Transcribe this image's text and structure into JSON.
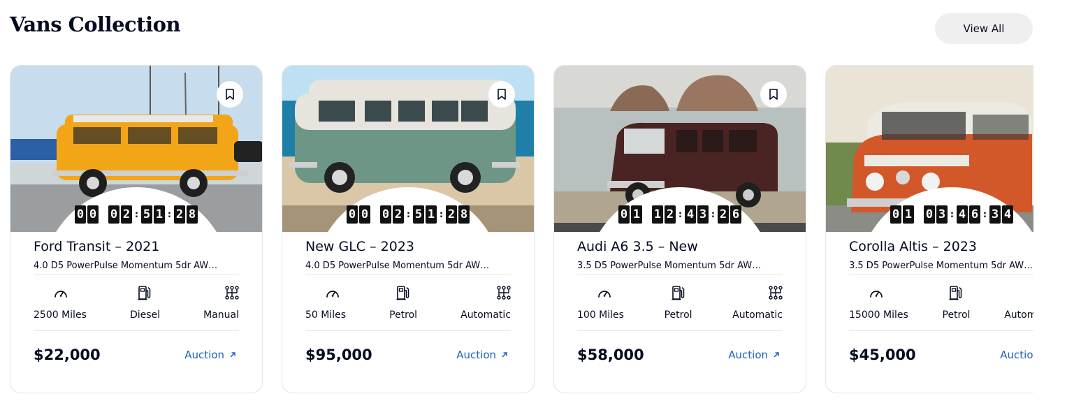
{
  "section": {
    "title": "Vans Collection",
    "view_all_label": "View All"
  },
  "cards": [
    {
      "title": "Ford Transit – 2021",
      "description": "4.0 D5 PowerPulse Momentum 5dr AW…",
      "timer": [
        "00",
        "02",
        "51",
        "28"
      ],
      "specs": [
        {
          "icon": "speedometer-icon",
          "label": "2500 Miles"
        },
        {
          "icon": "fuel-pump-icon",
          "label": "Diesel"
        },
        {
          "icon": "gearbox-icon",
          "label": "Manual"
        }
      ],
      "price": "$22,000",
      "link_label": "Auction",
      "van_color": "#f2a516"
    },
    {
      "title": "New GLC – 2023",
      "description": "4.0 D5 PowerPulse Momentum 5dr AW…",
      "timer": [
        "00",
        "02",
        "51",
        "28"
      ],
      "specs": [
        {
          "icon": "speedometer-icon",
          "label": "50 Miles"
        },
        {
          "icon": "fuel-pump-icon",
          "label": "Petrol"
        },
        {
          "icon": "gearbox-icon",
          "label": "Automatic"
        }
      ],
      "price": "$95,000",
      "link_label": "Auction",
      "van_color": "#6e9686"
    },
    {
      "title": "Audi A6 3.5 – New",
      "description": "3.5 D5 PowerPulse Momentum 5dr AW…",
      "timer": [
        "01",
        "12",
        "43",
        "26"
      ],
      "specs": [
        {
          "icon": "speedometer-icon",
          "label": "100 Miles"
        },
        {
          "icon": "fuel-pump-icon",
          "label": "Petrol"
        },
        {
          "icon": "gearbox-icon",
          "label": "Automatic"
        }
      ],
      "price": "$58,000",
      "link_label": "Auction",
      "van_color": "#4a2422"
    },
    {
      "title": "Corolla Altis – 2023",
      "description": "3.5 D5 PowerPulse Momentum 5dr AW…",
      "timer": [
        "01",
        "03",
        "46",
        "34"
      ],
      "specs": [
        {
          "icon": "speedometer-icon",
          "label": "15000 Miles"
        },
        {
          "icon": "fuel-pump-icon",
          "label": "Petrol"
        },
        {
          "icon": "gearbox-icon",
          "label": "Automatic"
        }
      ],
      "price": "$45,000",
      "link_label": "Auction",
      "van_color": "#d2582a"
    }
  ],
  "colors": {
    "text": "#050b20",
    "link": "#1f5fc7",
    "button_bg": "#efefef",
    "border": "#e4e6ea"
  }
}
